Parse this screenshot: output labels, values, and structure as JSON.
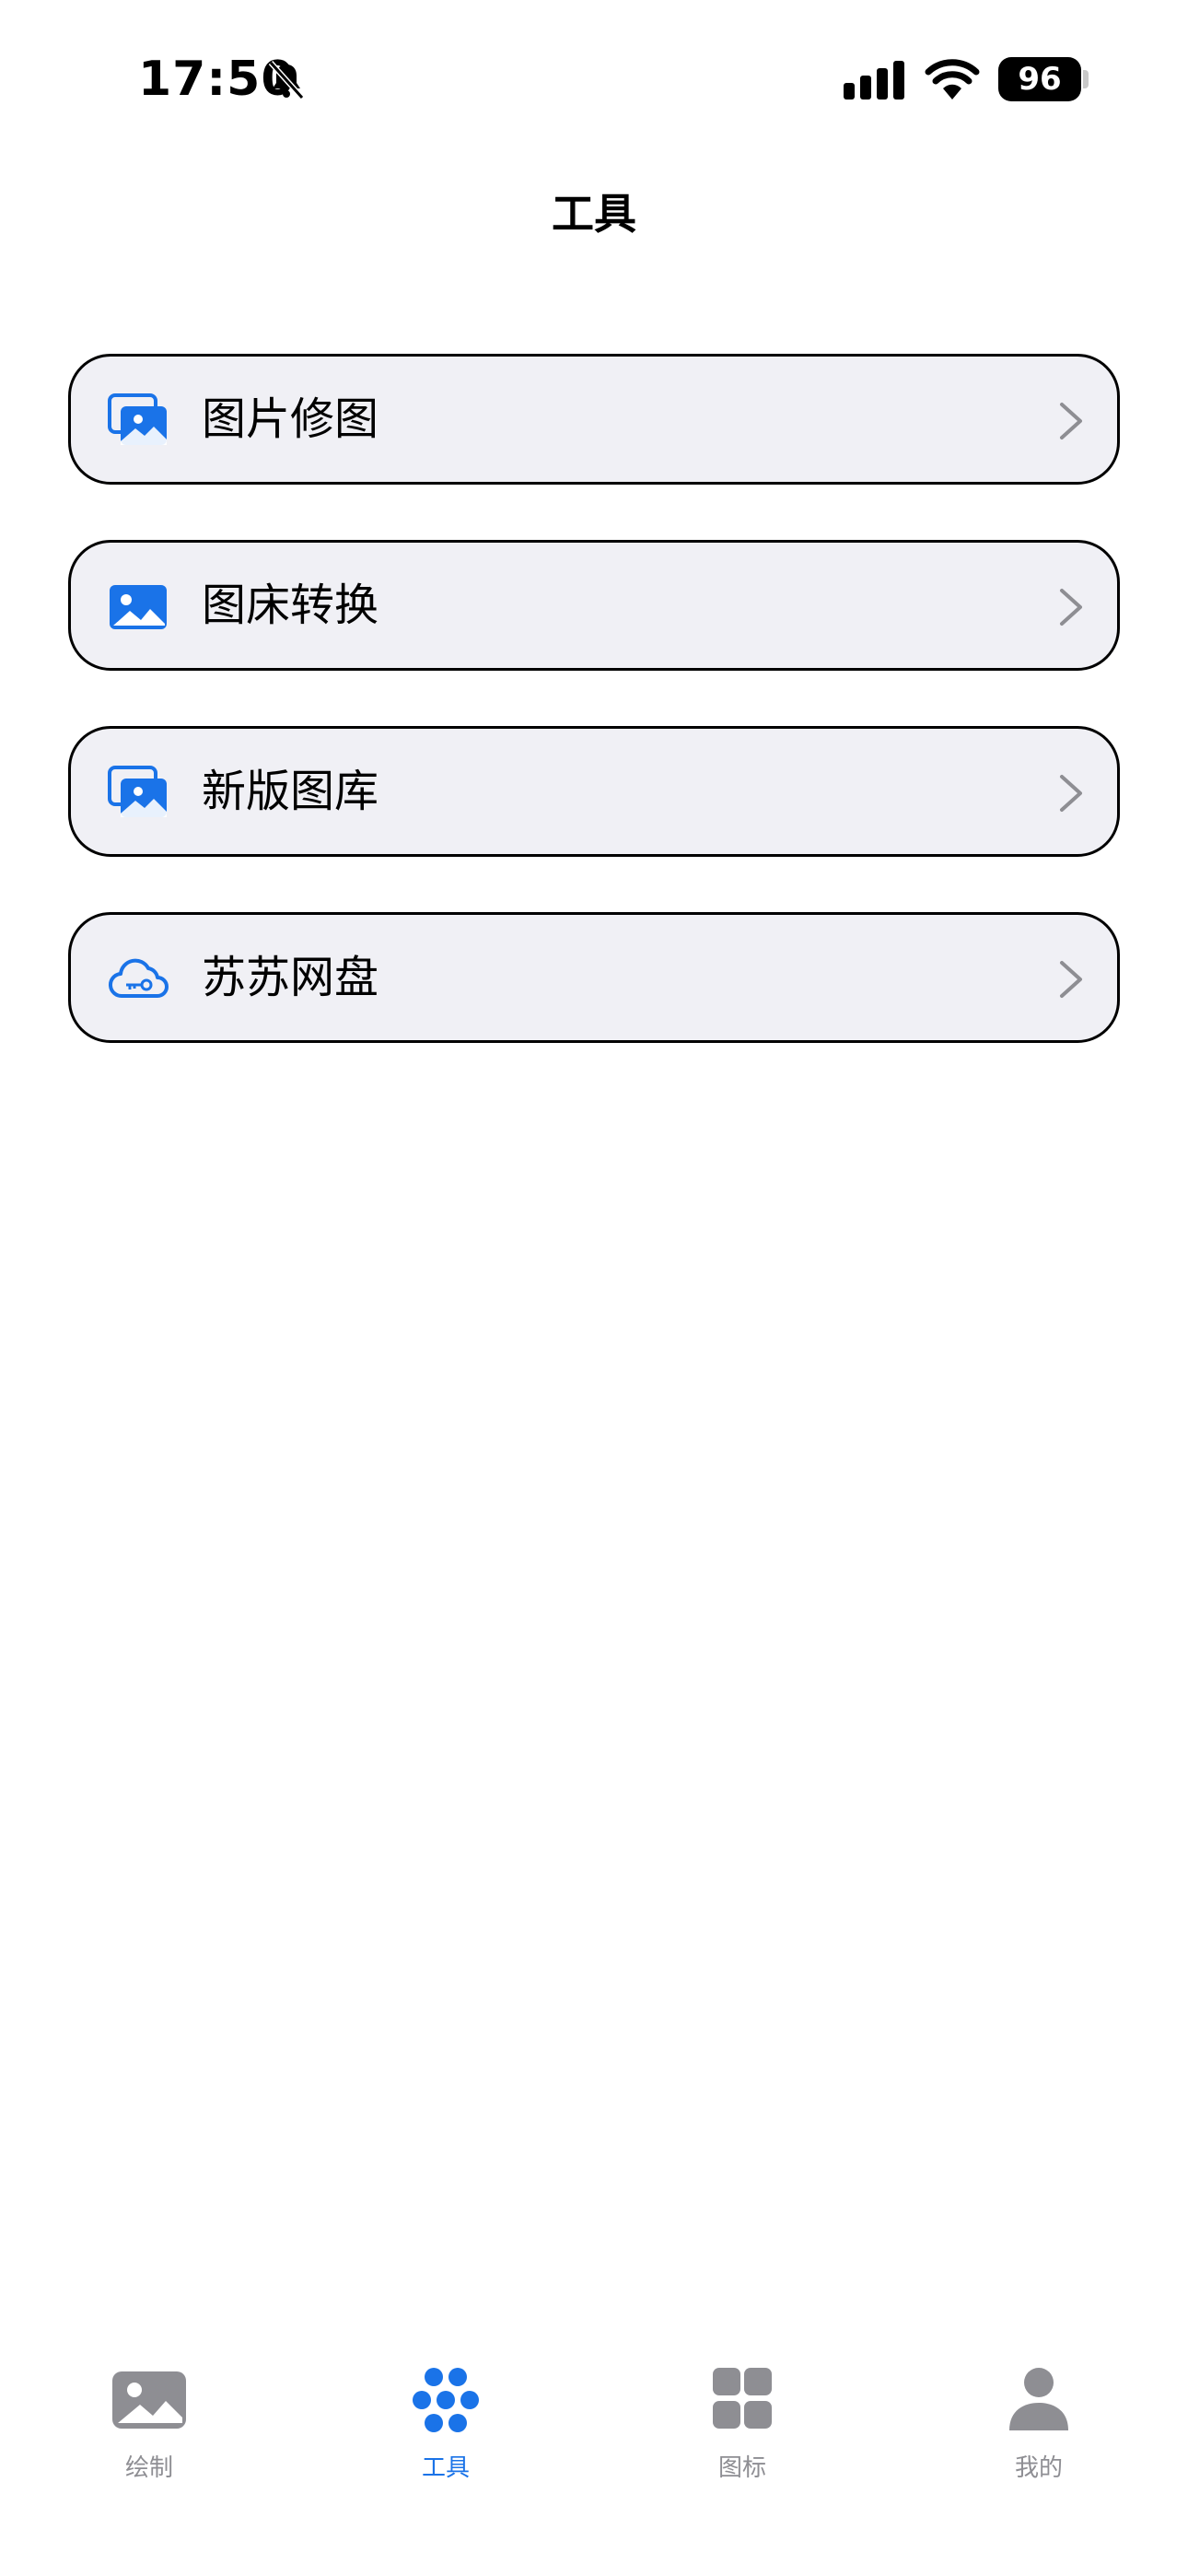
{
  "status_bar": {
    "time": "17:50",
    "battery": "96",
    "icons": [
      "bell-slash-icon",
      "cellular-signal-icon",
      "wifi-icon",
      "battery-icon"
    ]
  },
  "header": {
    "title": "工具"
  },
  "menu": {
    "items": [
      {
        "label": "图片修图",
        "icon": "photo-stack-icon"
      },
      {
        "label": "图床转换",
        "icon": "photo-icon"
      },
      {
        "label": "新版图库",
        "icon": "photo-stack-icon"
      },
      {
        "label": "苏苏网盘",
        "icon": "cloud-key-icon"
      }
    ]
  },
  "tab_bar": {
    "tabs": [
      {
        "label": "绘制",
        "icon": "photo-icon",
        "active": false
      },
      {
        "label": "工具",
        "icon": "dots-cluster-icon",
        "active": true
      },
      {
        "label": "图标",
        "icon": "grid-icon",
        "active": false
      },
      {
        "label": "我的",
        "icon": "person-icon",
        "active": false
      }
    ]
  },
  "colors": {
    "accent": "#1a73e8",
    "inactive": "#8e8e93",
    "card_background": "#f0f0f5"
  }
}
